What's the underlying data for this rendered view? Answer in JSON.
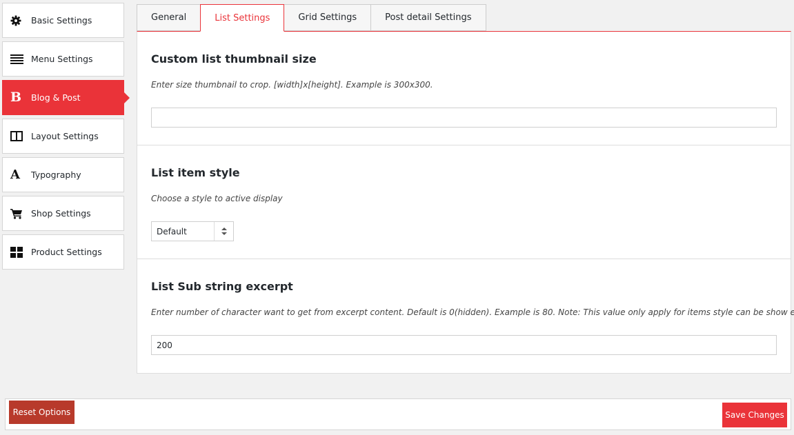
{
  "sidebar": {
    "items": [
      {
        "label": "Basic Settings",
        "icon": "gear-icon",
        "active": false
      },
      {
        "label": "Menu Settings",
        "icon": "menu-lines-icon",
        "active": false
      },
      {
        "label": "Blog & Post",
        "icon": "letter-b-icon",
        "glyph": "B",
        "active": true
      },
      {
        "label": "Layout Settings",
        "icon": "columns-icon",
        "active": false
      },
      {
        "label": "Typography",
        "icon": "letter-a-icon",
        "glyph": "A",
        "active": false
      },
      {
        "label": "Shop Settings",
        "icon": "cart-icon",
        "active": false
      },
      {
        "label": "Product Settings",
        "icon": "grid-icon",
        "active": false
      }
    ]
  },
  "tabs": [
    {
      "label": "General",
      "active": false
    },
    {
      "label": "List Settings",
      "active": true
    },
    {
      "label": "Grid Settings",
      "active": false
    },
    {
      "label": "Post detail Settings",
      "active": false
    }
  ],
  "sections": {
    "thumbnail": {
      "title": "Custom list thumbnail size",
      "desc": "Enter size thumbnail to crop. [width]x[height]. Example is 300x300.",
      "value": ""
    },
    "item_style": {
      "title": "List item style",
      "desc": "Choose a style to active display",
      "selected": "Default"
    },
    "excerpt": {
      "title": "List Sub string excerpt",
      "desc": "Enter number of character want to get from excerpt content. Default is 0(hidden). Example is 80. Note: This value only apply for items style can be show excerpt.",
      "value": "200"
    }
  },
  "footer": {
    "reset_label": "Reset Options",
    "save_label": "Save Changes"
  },
  "colors": {
    "accent": "#ea3339",
    "reset": "#b83a2b"
  }
}
